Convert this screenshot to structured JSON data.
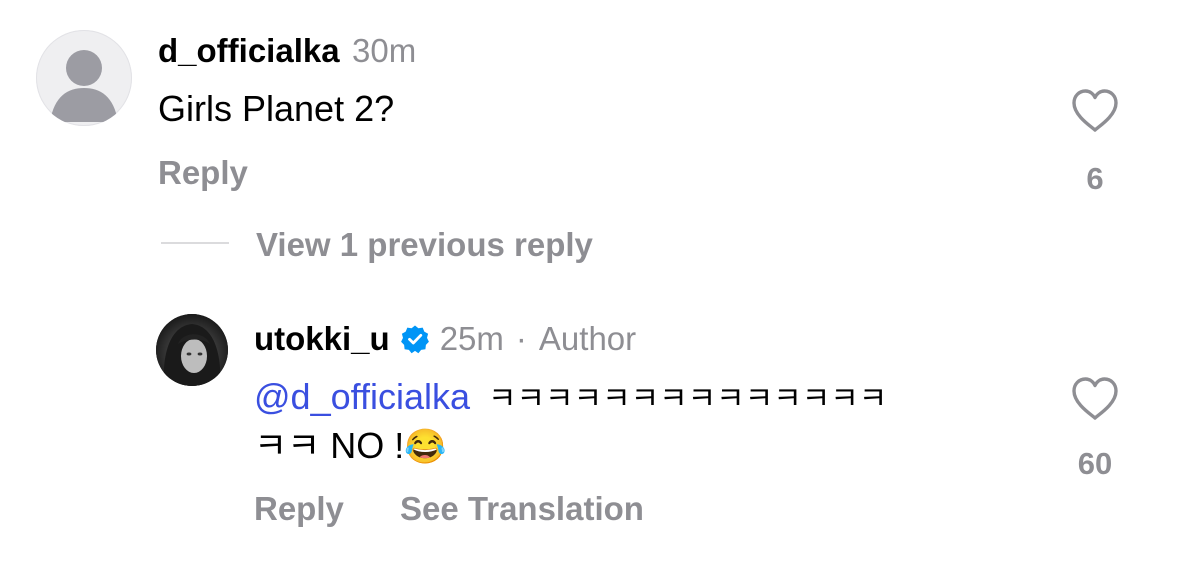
{
  "comments": [
    {
      "username": "d_officialka",
      "time": "30m",
      "text": "Girls Planet 2?",
      "reply_label": "Reply",
      "like_count": "6"
    }
  ],
  "view_replies_label": "View 1 previous reply",
  "reply": {
    "username": "utokki_u",
    "verified": true,
    "time": "25m",
    "separator": "·",
    "author_tag": "Author",
    "mention": "@d_officialka",
    "text_line1": "ㅋㅋㅋㅋㅋㅋㅋㅋㅋㅋㅋㅋㅋㅋ",
    "text_line2": "ㅋㅋ NO !",
    "emoji": "😂",
    "reply_label": "Reply",
    "see_translation_label": "See Translation",
    "like_count": "60"
  },
  "colors": {
    "secondary_text": "#8e8e93",
    "mention": "#3a4fe0",
    "verified_badge": "#0095f6"
  }
}
